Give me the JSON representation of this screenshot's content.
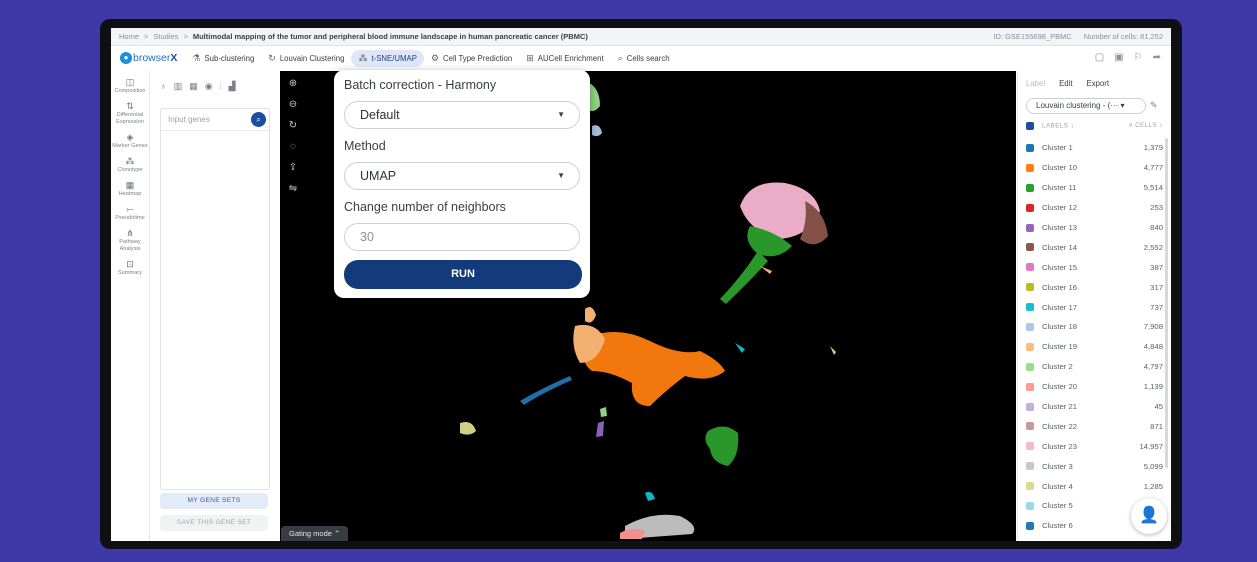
{
  "breadcrumb": {
    "items": [
      "Home",
      "Studies"
    ],
    "separator": ">",
    "title": "Multimodal mapping of the tumor and peripheral blood immune landscape in human pancreatic cancer (PBMC)",
    "id_text": "ID: GSE155698_PBMC",
    "cells_text": "Number of cells: 81,252"
  },
  "logo": {
    "mark": "●",
    "prefix": "browser",
    "suffix": "X"
  },
  "toolbar": {
    "items": [
      {
        "label": "Sub-clustering",
        "icon": "⚗"
      },
      {
        "label": "Louvain Clustering",
        "icon": "↻"
      },
      {
        "label": "t-SNE/UMAP",
        "icon": "⁂"
      },
      {
        "label": "Cell Type Prediction",
        "icon": "⚙"
      },
      {
        "label": "AUCell Enrichment",
        "icon": "⊞"
      },
      {
        "label": "Cells search",
        "icon": "⌕"
      }
    ],
    "right_icons": [
      "▢",
      "▣",
      "⚐",
      "➦"
    ]
  },
  "leftnav": [
    {
      "label": "Composition",
      "icon": "◫"
    },
    {
      "label": "Differential Expression",
      "icon": "⇅"
    },
    {
      "label": "Marker Genes",
      "icon": "◈"
    },
    {
      "label": "Clonotype",
      "icon": "⁂"
    },
    {
      "label": "Heatmap",
      "icon": "▦"
    },
    {
      "label": "Pseudotime",
      "icon": "⤚"
    },
    {
      "label": "Pathway Analysis",
      "icon": "⋔"
    },
    {
      "label": "Summary",
      "icon": "⊡"
    }
  ],
  "genes": {
    "tool_icons": [
      "♁",
      "▥",
      "▦",
      "◉",
      "⦙",
      "▟"
    ],
    "placeholder": "Input genes",
    "search_icon": "⌕",
    "my_gene_sets": "MY GENE SETS",
    "save_gene_set": "SAVE THIS GENE SET"
  },
  "plot": {
    "zoom_icons": [
      "⊕",
      "⊖",
      "↻",
      "◌",
      "⇪",
      "⇋"
    ],
    "gating": "Gating mode ⌃"
  },
  "popup": {
    "batch_label": "Batch correction - Harmony",
    "batch_value": "Default",
    "method_label": "Method",
    "method_value": "UMAP",
    "neighbors_label": "Change number of neighbors",
    "neighbors_value": "30",
    "run": "RUN",
    "caret": "▼"
  },
  "right": {
    "label_btn": "Label",
    "edit_btn": "Edit",
    "export_btn": "Export",
    "clustering_select": "Louvain clustering - (··· ▾",
    "edit_icon": "✎",
    "labels_header": "LABELS ↕",
    "cells_header": "# CELLS ↕",
    "clusters": [
      {
        "label": "Cluster 1",
        "count": "1,379",
        "color": "#1f77b4"
      },
      {
        "label": "Cluster 10",
        "count": "4,777",
        "color": "#ff7f0e"
      },
      {
        "label": "Cluster 11",
        "count": "5,514",
        "color": "#2ca02c"
      },
      {
        "label": "Cluster 12",
        "count": "253",
        "color": "#d62728"
      },
      {
        "label": "Cluster 13",
        "count": "840",
        "color": "#9467bd"
      },
      {
        "label": "Cluster 14",
        "count": "2,552",
        "color": "#8c564b"
      },
      {
        "label": "Cluster 15",
        "count": "387",
        "color": "#e377c2"
      },
      {
        "label": "Cluster 16",
        "count": "317",
        "color": "#bcbd22"
      },
      {
        "label": "Cluster 17",
        "count": "737",
        "color": "#17becf"
      },
      {
        "label": "Cluster 18",
        "count": "7,908",
        "color": "#aec7e8"
      },
      {
        "label": "Cluster 19",
        "count": "4,848",
        "color": "#ffbb78"
      },
      {
        "label": "Cluster 2",
        "count": "4,797",
        "color": "#98df8a"
      },
      {
        "label": "Cluster 20",
        "count": "1,139",
        "color": "#ff9896"
      },
      {
        "label": "Cluster 21",
        "count": "45",
        "color": "#c5b0d5"
      },
      {
        "label": "Cluster 22",
        "count": "871",
        "color": "#c49c94"
      },
      {
        "label": "Cluster 23",
        "count": "14,957",
        "color": "#f7b6d2"
      },
      {
        "label": "Cluster 3",
        "count": "5,099",
        "color": "#c7c7c7"
      },
      {
        "label": "Cluster 4",
        "count": "1,285",
        "color": "#dbdb8d"
      },
      {
        "label": "Cluster 5",
        "count": "",
        "color": "#9edae5"
      },
      {
        "label": "Cluster 6",
        "count": "",
        "color": "#1f77b4"
      }
    ]
  },
  "fab_icon": "👤"
}
